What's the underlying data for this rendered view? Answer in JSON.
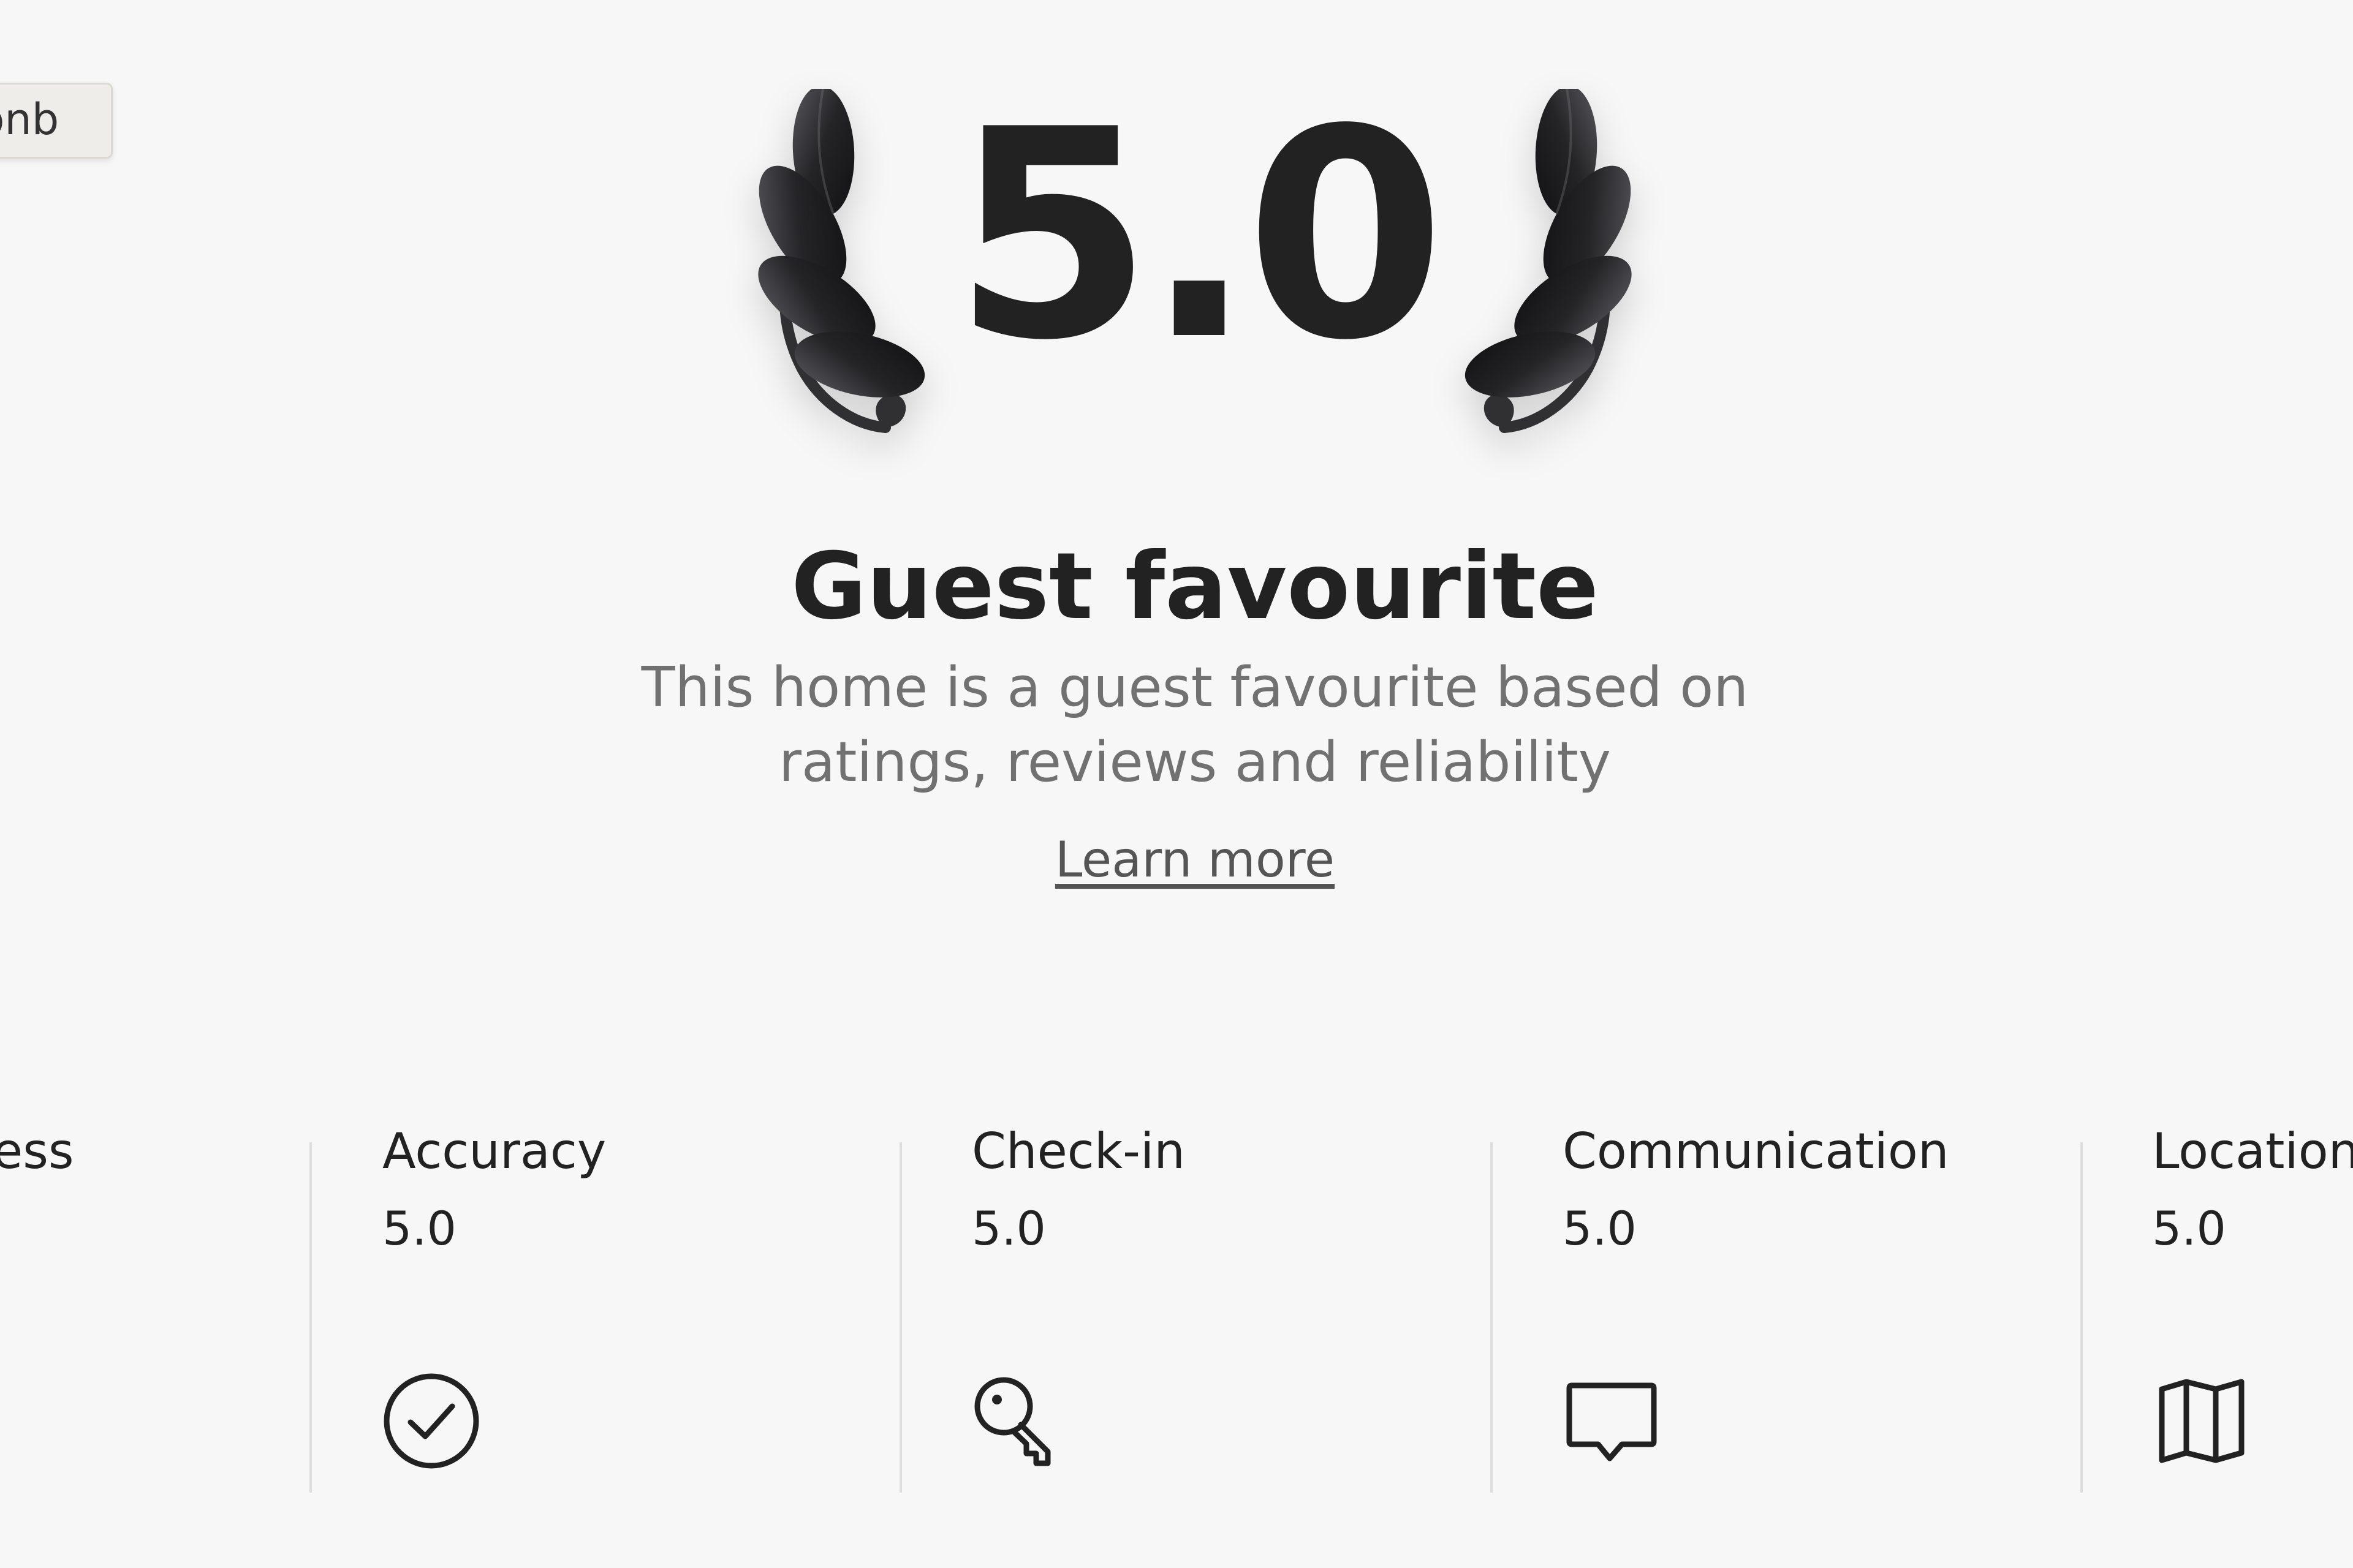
{
  "tooltip": {
    "text": "bnb"
  },
  "rating": {
    "value": "5.0",
    "title": "Guest favourite",
    "subtitle": "This home is a guest favourite based on ratings, reviews and reliability",
    "learn_more": "Learn more"
  },
  "categories": [
    {
      "label": "ess",
      "score": "",
      "icon": "none"
    },
    {
      "label": "Accuracy",
      "score": "5.0",
      "icon": "check-circle-icon"
    },
    {
      "label": "Check-in",
      "score": "5.0",
      "icon": "key-icon"
    },
    {
      "label": "Communication",
      "score": "5.0",
      "icon": "chat-bubble-icon"
    },
    {
      "label": "Location",
      "score": "5.0",
      "icon": "map-icon"
    }
  ],
  "colors": {
    "background": "#f7f7f7",
    "text_primary": "#222222",
    "text_secondary": "#717171",
    "divider": "#dddddd"
  }
}
